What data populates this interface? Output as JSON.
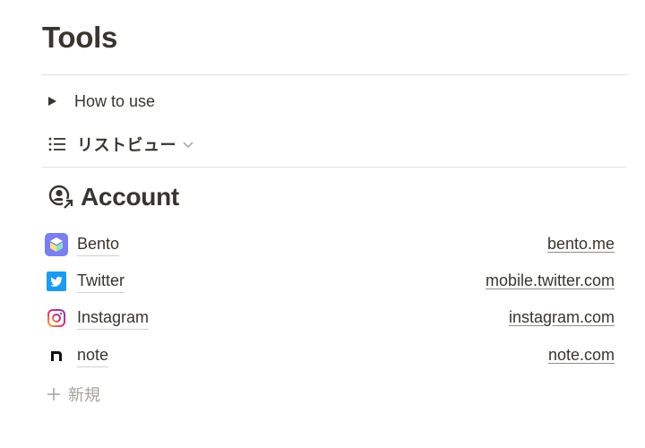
{
  "page": {
    "title": "Tools"
  },
  "toggle": {
    "label": "How to use"
  },
  "view": {
    "label": "リストビュー",
    "icon": "list-icon"
  },
  "database": {
    "title": "Account",
    "icon": "account-link-icon",
    "rows": [
      {
        "name": "Bento",
        "url": "bento.me",
        "icon": "bento-logo-icon"
      },
      {
        "name": "Twitter",
        "url": "mobile.twitter.com",
        "icon": "twitter-logo-icon"
      },
      {
        "name": "Instagram",
        "url": "instagram.com",
        "icon": "instagram-logo-icon"
      },
      {
        "name": "note",
        "url": "note.com",
        "icon": "note-logo-icon"
      }
    ],
    "new_label": "新規"
  },
  "colors": {
    "text": "#37352f",
    "muted": "#a5a39e",
    "divider": "#e3e2e0",
    "twitter": "#1d9bf0",
    "bento": "#7a7ff0"
  }
}
